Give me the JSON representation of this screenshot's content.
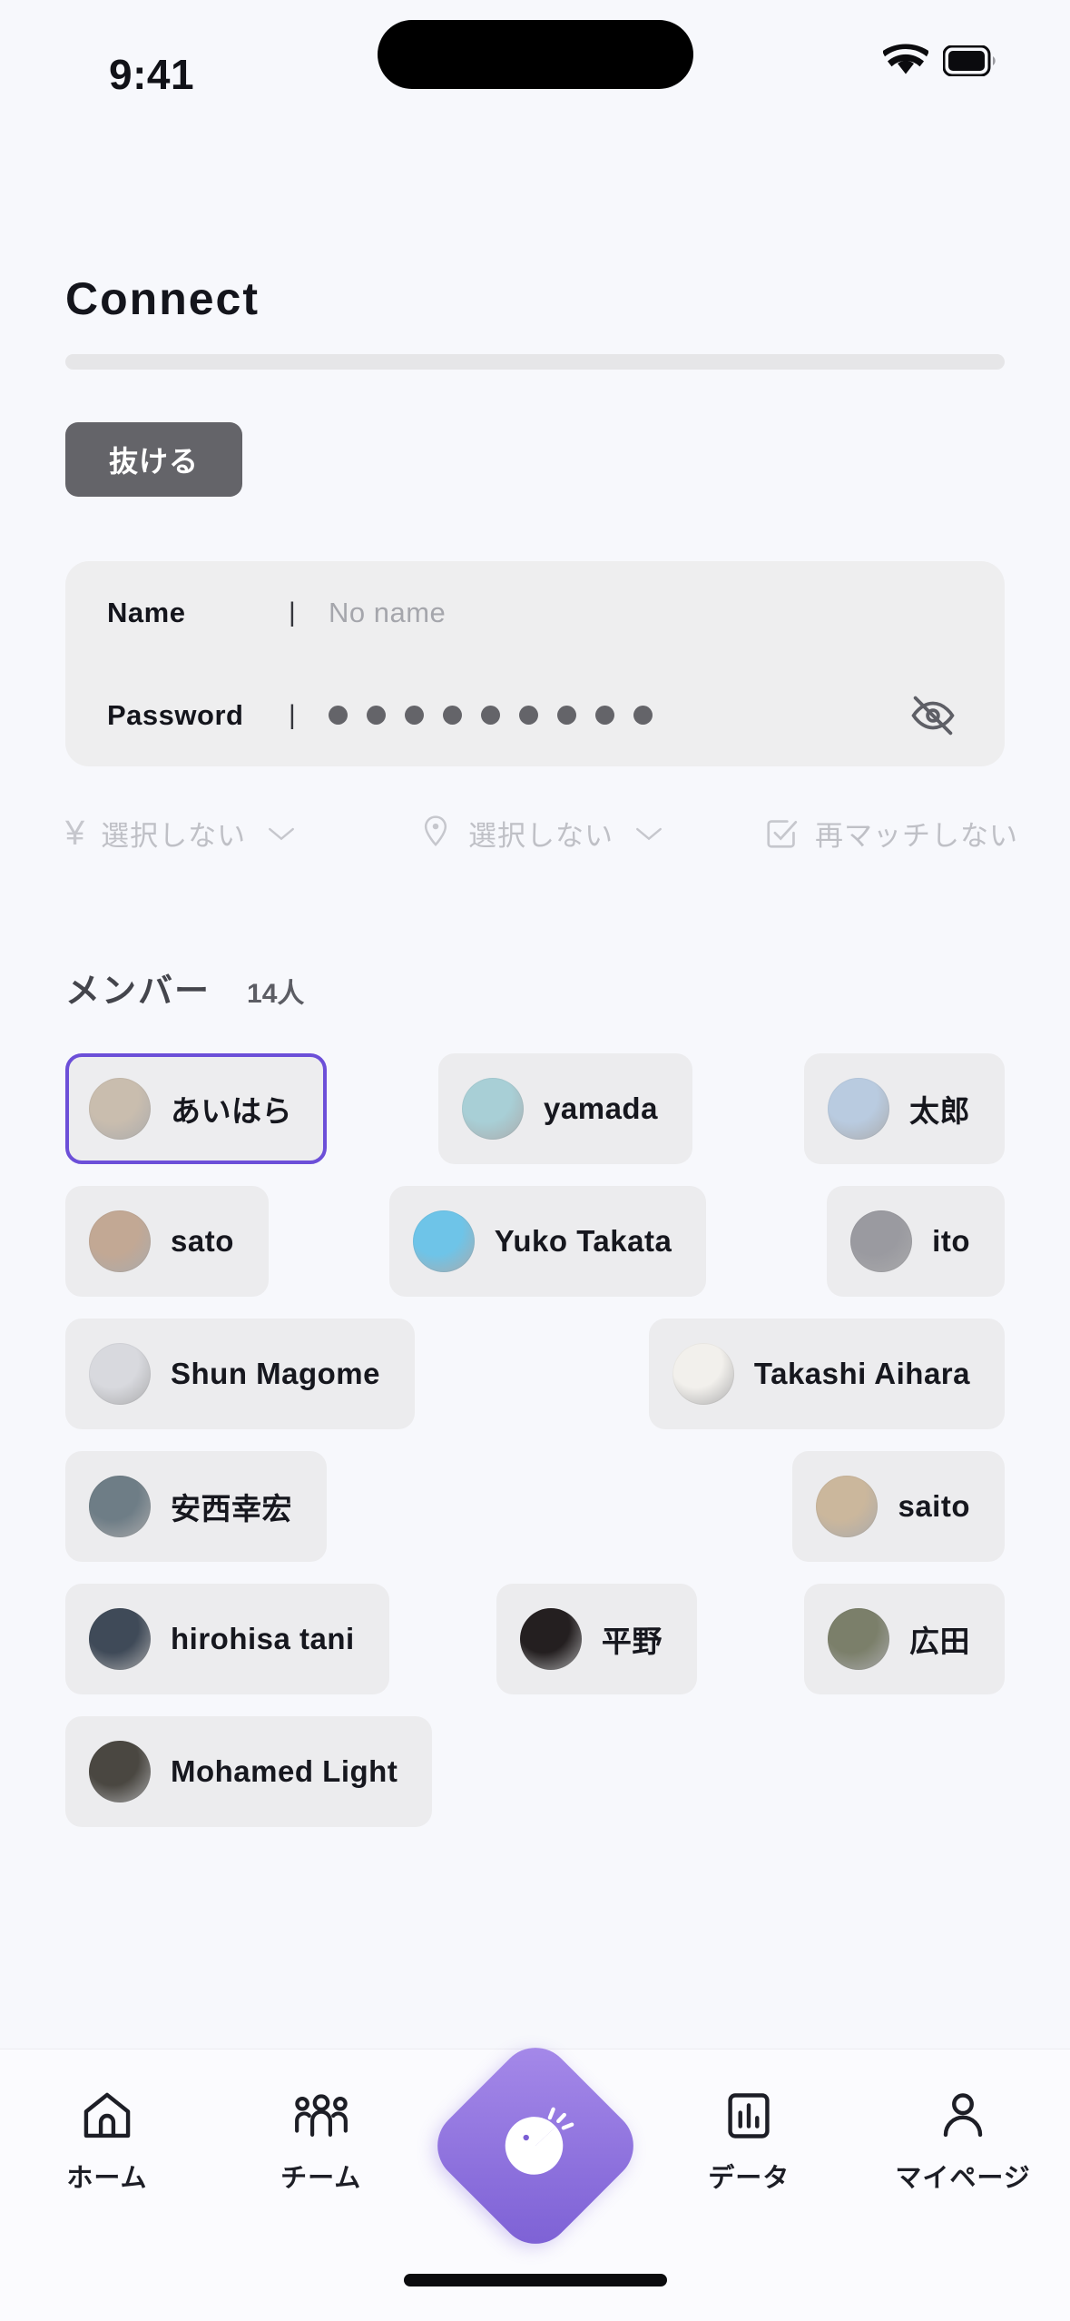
{
  "status_bar": {
    "time": "9:41",
    "wifi_icon": "wifi-icon",
    "battery_icon": "battery-icon"
  },
  "header": {
    "title": "Connect",
    "progress_percent": 0
  },
  "leave_button": {
    "label": "抜ける"
  },
  "credentials": {
    "name_label": "Name",
    "name_value": "No name",
    "separator": "|",
    "password_label": "Password",
    "password_dots": 9,
    "password_visible": false,
    "toggle_icon": "eye-off-icon"
  },
  "filters": [
    {
      "icon": "yen-icon",
      "glyph": "¥",
      "label": "選択しない",
      "has_chevron": true
    },
    {
      "icon": "location-pin-icon",
      "label": "選択しない",
      "has_chevron": true
    },
    {
      "icon": "check-square-icon",
      "label": "再マッチしない",
      "has_chevron": false
    }
  ],
  "members": {
    "title": "メンバー",
    "count_label": "14人",
    "rows": [
      [
        {
          "name": "あいはら",
          "selected": true,
          "avatar_tone": "#c9bdae"
        },
        {
          "name": "yamada",
          "selected": false,
          "avatar_tone": "#a8cfd6"
        },
        {
          "name": "太郎",
          "selected": false,
          "avatar_tone": "#b9cbe0"
        }
      ],
      [
        {
          "name": "sato",
          "selected": false,
          "avatar_tone": "#c2a894"
        },
        {
          "name": "Yuko Takata",
          "selected": false,
          "avatar_tone": "#6ec4e8"
        },
        {
          "name": "ito",
          "selected": false,
          "avatar_tone": "#9a9aa0"
        }
      ],
      [
        {
          "name": "Shun Magome",
          "selected": false,
          "avatar_tone": "#d8d9de"
        },
        {
          "name": "Takashi Aihara",
          "selected": false,
          "avatar_tone": "#f2f0ec"
        }
      ],
      [
        {
          "name": "安西幸宏",
          "selected": false,
          "avatar_tone": "#6e7d86"
        },
        {
          "name": "saito",
          "selected": false,
          "avatar_tone": "#cbb79c"
        }
      ],
      [
        {
          "name": "hirohisa tani",
          "selected": false,
          "avatar_tone": "#3f4a58"
        },
        {
          "name": "平野",
          "selected": false,
          "avatar_tone": "#241f20"
        },
        {
          "name": "広田",
          "selected": false,
          "avatar_tone": "#7b7f6a"
        }
      ],
      [
        {
          "name": "Mohamed Light",
          "selected": false,
          "avatar_tone": "#4a4741"
        }
      ]
    ]
  },
  "bottom_nav": {
    "items": [
      {
        "label": "ホーム",
        "icon": "home-icon"
      },
      {
        "label": "チーム",
        "icon": "team-icon"
      },
      {
        "label": "",
        "icon": "fab-pie-icon"
      },
      {
        "label": "データ",
        "icon": "bar-chart-icon"
      },
      {
        "label": "マイページ",
        "icon": "person-icon"
      }
    ],
    "fab_icon": "fab-pie-icon",
    "accent_color": "#7b5fd4"
  }
}
